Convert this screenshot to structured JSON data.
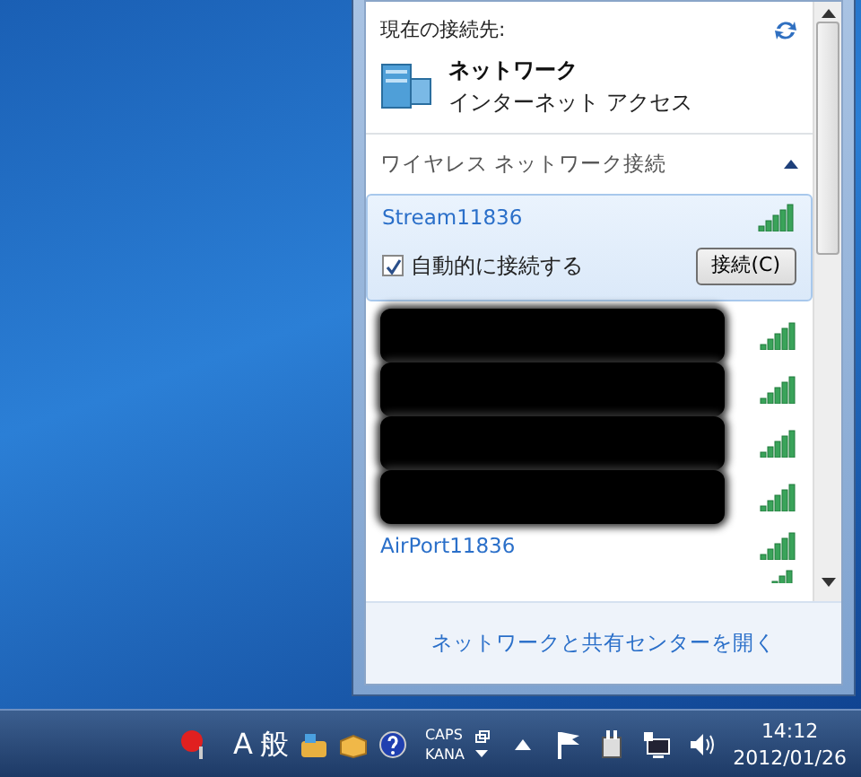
{
  "current_connection": {
    "heading": "現在の接続先:",
    "network_name": "ネットワーク",
    "access": "インターネット アクセス"
  },
  "section": {
    "title": "ワイヤレス ネットワーク接続",
    "expanded": true
  },
  "networks": [
    {
      "kind": "network",
      "name": "Stream11836",
      "selected": true,
      "auto_connect": {
        "label": "自動的に接続する",
        "checked": true
      },
      "button": "接続(C)"
    },
    {
      "kind": "redacted",
      "selected": false
    },
    {
      "kind": "redacted",
      "selected": false
    },
    {
      "kind": "redacted",
      "selected": false
    },
    {
      "kind": "redacted",
      "selected": false
    },
    {
      "kind": "network",
      "name": "AirPort11836",
      "selected": false
    },
    {
      "kind": "partial",
      "selected": false
    }
  ],
  "footer_link": "ネットワークと共有センターを開く",
  "taskbar": {
    "ime": [
      "A",
      "般"
    ],
    "caps": "CAPS",
    "kana": "KANA",
    "time": "14:12",
    "date": "2012/01/26"
  }
}
